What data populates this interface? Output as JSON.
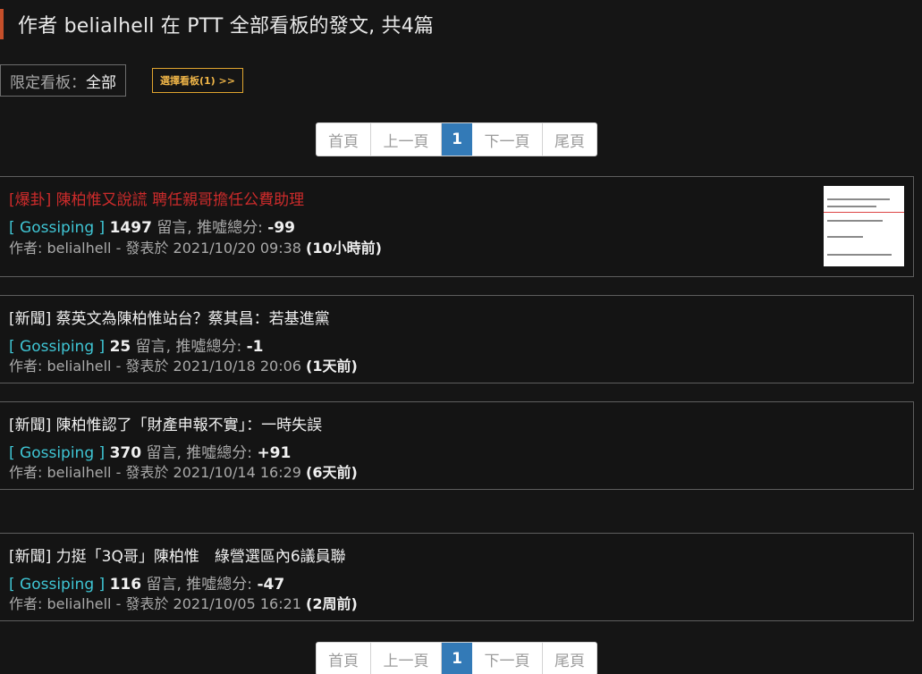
{
  "header": {
    "title": "作者 belialhell 在 PTT 全部看板的發文, 共4篇"
  },
  "filter": {
    "label": "限定看板：",
    "value": "全部",
    "select_button": "選擇看板(1) >>"
  },
  "pagination": {
    "first": "首頁",
    "prev": "上一頁",
    "current": "1",
    "next": "下一頁",
    "last": "尾頁"
  },
  "posts": [
    {
      "title": "[爆卦] 陳柏惟又說謊 聘任親哥擔任公費助理",
      "board": "[ Gossiping ]",
      "comments": "1497",
      "comments_label": "留言, 推噓總分:",
      "score": "-99",
      "author_line": "作者: belialhell - 發表於 2021/10/20 09:38",
      "ago": "(10小時前)"
    },
    {
      "title": "[新聞] 蔡英文為陳柏惟站台？蔡其昌：若基進黨",
      "board": "[ Gossiping ]",
      "comments": "25",
      "comments_label": "留言, 推噓總分:",
      "score": "-1",
      "author_line": "作者: belialhell - 發表於 2021/10/18 20:06",
      "ago": "(1天前)"
    },
    {
      "title": "[新聞] 陳柏惟認了「財產申報不實」：一時失誤",
      "board": "[ Gossiping ]",
      "comments": "370",
      "comments_label": "留言, 推噓總分:",
      "score": "+91",
      "author_line": "作者: belialhell - 發表於 2021/10/14 16:29",
      "ago": "(6天前)"
    },
    {
      "title": "[新聞] 力挺「3Q哥」陳柏惟　綠營選區內6議員聯",
      "board": "[ Gossiping ]",
      "comments": "116",
      "comments_label": "留言, 推噓總分:",
      "score": "-47",
      "author_line": "作者: belialhell - 發表於 2021/10/05 16:21",
      "ago": "(2周前)"
    }
  ],
  "colors": {
    "accent": "#c54f2a",
    "hot_title": "#cc2b2b",
    "board_tag": "#3fc5d4",
    "select_button": "#efb548",
    "pager_active": "#337ab7"
  }
}
